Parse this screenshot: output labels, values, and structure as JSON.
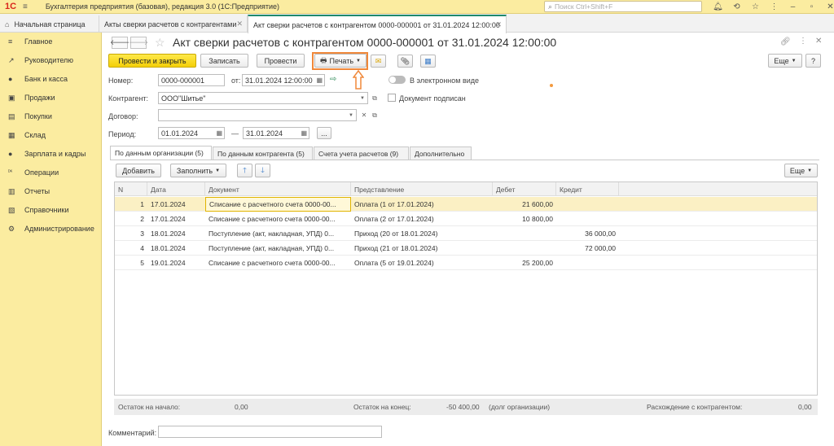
{
  "app": {
    "logo": "1С",
    "title": "Бухгалтерия предприятия (базовая), редакция 3.0  (1С:Предприятие)",
    "search_placeholder": "Поиск Ctrl+Shift+F"
  },
  "tabs": [
    {
      "label": "Начальная страница"
    },
    {
      "label": "Акты сверки расчетов с контрагентами"
    },
    {
      "label": "Акт сверки расчетов с контрагентом 0000-000001 от 31.01.2024 12:00:00"
    }
  ],
  "sidebar": {
    "items": [
      {
        "label": "Главное",
        "icon": "≡"
      },
      {
        "label": "Руководителю",
        "icon": "↗"
      },
      {
        "label": "Банк и касса",
        "icon": "●"
      },
      {
        "label": "Продажи",
        "icon": "▣"
      },
      {
        "label": "Покупки",
        "icon": "▤"
      },
      {
        "label": "Склад",
        "icon": "▦"
      },
      {
        "label": "Зарплата и кадры",
        "icon": "●"
      },
      {
        "label": "Операции",
        "icon": "ᴰᴷ"
      },
      {
        "label": "Отчеты",
        "icon": "▥"
      },
      {
        "label": "Справочники",
        "icon": "▧"
      },
      {
        "label": "Администрирование",
        "icon": "⚙"
      }
    ]
  },
  "document": {
    "title": "Акт сверки расчетов с контрагентом 0000-000001 от 31.01.2024 12:00:00"
  },
  "toolbar": {
    "post_close": "Провести и закрыть",
    "save": "Записать",
    "post": "Провести",
    "print": "Печать",
    "more": "Еще"
  },
  "form": {
    "number_label": "Номер:",
    "number": "0000-000001",
    "date_label": "от:",
    "date": "31.01.2024 12:00:00",
    "electronic_label": "В электронном виде",
    "counterparty_label": "Контрагент:",
    "counterparty": "ООО\"Шитье\"",
    "signed_label": "Документ подписан",
    "contract_label": "Договор:",
    "contract": "",
    "period_label": "Период:",
    "period_from": "01.01.2024",
    "period_dash": "—",
    "period_to": "31.01.2024",
    "ellipsis": "..."
  },
  "form_tabs": [
    {
      "label": "По данным организации (5)"
    },
    {
      "label": "По данным контрагента (5)"
    },
    {
      "label": "Счета учета расчетов (9)"
    },
    {
      "label": "Дополнительно"
    }
  ],
  "table_toolbar": {
    "add": "Добавить",
    "fill": "Заполнить",
    "more": "Еще"
  },
  "table": {
    "columns": [
      "N",
      "Дата",
      "Документ",
      "Представление",
      "Дебет",
      "Кредит"
    ],
    "rows": [
      {
        "n": "1",
        "date": "17.01.2024",
        "doc": "Списание с расчетного счета 0000-00...",
        "repr": "Оплата (1 от 17.01.2024)",
        "debit": "21 600,00",
        "credit": ""
      },
      {
        "n": "2",
        "date": "17.01.2024",
        "doc": "Списание с расчетного счета 0000-00...",
        "repr": "Оплата (2 от 17.01.2024)",
        "debit": "10 800,00",
        "credit": ""
      },
      {
        "n": "3",
        "date": "18.01.2024",
        "doc": "Поступление (акт, накладная, УПД) 0...",
        "repr": "Приход (20 от 18.01.2024)",
        "debit": "",
        "credit": "36 000,00"
      },
      {
        "n": "4",
        "date": "18.01.2024",
        "doc": "Поступление (акт, накладная, УПД) 0...",
        "repr": "Приход (21 от 18.01.2024)",
        "debit": "",
        "credit": "72 000,00"
      },
      {
        "n": "5",
        "date": "19.01.2024",
        "doc": "Списание с расчетного счета 0000-00...",
        "repr": "Оплата (5 от 19.01.2024)",
        "debit": "25 200,00",
        "credit": ""
      }
    ]
  },
  "footer": {
    "start_label": "Остаток на начало:",
    "start_value": "0,00",
    "end_label": "Остаток на конец:",
    "end_value": "-50 400,00",
    "end_note": "(долг организации)",
    "diff_label": "Расхождение с контрагентом:",
    "diff_value": "0,00"
  },
  "comment_label": "Комментарий:"
}
